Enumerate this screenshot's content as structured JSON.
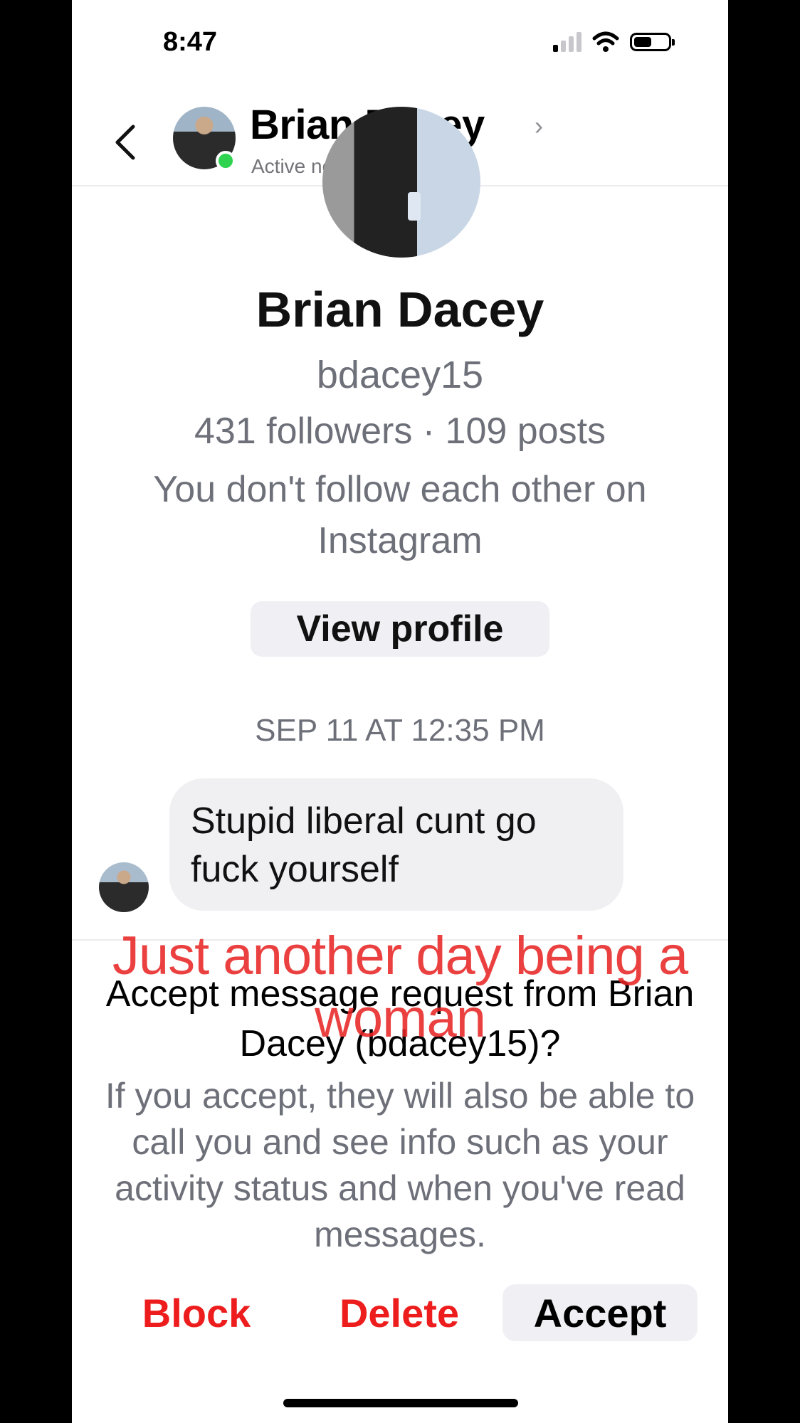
{
  "status_bar": {
    "time": "8:47"
  },
  "header": {
    "name": "Brian Dacey",
    "status": "Active now",
    "chevron": "›"
  },
  "profile": {
    "name": "Brian Dacey",
    "username": "bdacey15",
    "stats": "431 followers · 109 posts",
    "follow_note": "You don't follow each other on Instagram",
    "view_profile_label": "View profile"
  },
  "conversation": {
    "date": "SEP 11 AT 12:35 PM",
    "messages": [
      {
        "text": "Stupid liberal cunt go fuck yourself"
      }
    ]
  },
  "request": {
    "title": "Accept message request from Brian Dacey (bdacey15)?",
    "description": "If you accept, they will also be able to call you and see info such as your activity status and when you've read messages."
  },
  "overlay_caption": "Just another day being a woman",
  "actions": {
    "block_label": "Block",
    "delete_label": "Delete",
    "accept_label": "Accept"
  },
  "icons": {
    "back": "back-chevron-icon",
    "signal": "cellular-signal-icon",
    "wifi": "wifi-icon",
    "battery": "battery-icon"
  },
  "colors": {
    "destructive": "#ee1d1d",
    "online": "#2fd34f",
    "secondary_text": "#6d7079",
    "bubble": "#f0f0f3",
    "overlay": "#e82626"
  }
}
